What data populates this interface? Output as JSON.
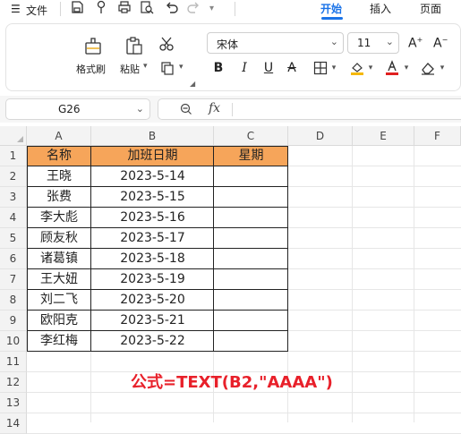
{
  "menubar": {
    "file_label": "文件",
    "tabs": [
      {
        "label": "开始",
        "active": true
      },
      {
        "label": "插入",
        "active": false
      },
      {
        "label": "页面",
        "active": false
      }
    ],
    "accent_color": "#1a73e8"
  },
  "ribbon": {
    "format_painter_label": "格式刷",
    "paste_label": "粘贴",
    "font_name": "宋体",
    "font_size": "11",
    "icons": [
      "format-painter-icon",
      "paste-icon",
      "cut-icon",
      "copy-icon",
      "increase-font-icon",
      "decrease-font-icon",
      "bold-icon",
      "italic-icon",
      "underline-icon",
      "strikethrough-icon",
      "border-icon",
      "fill-color-icon",
      "font-color-icon",
      "clear-icon"
    ],
    "fill_color": "#f5b800",
    "font_color": "#e02020"
  },
  "formula_bar": {
    "cell_ref": "G26",
    "fx_label": "fx",
    "content": ""
  },
  "sheet": {
    "columns": [
      "A",
      "B",
      "C",
      "D",
      "E",
      "F"
    ],
    "rows": [
      "1",
      "2",
      "3",
      "4",
      "5",
      "6",
      "7",
      "8",
      "9",
      "10",
      "11",
      "12",
      "13",
      "14"
    ],
    "table": {
      "headers": [
        "名称",
        "加班日期",
        "星期"
      ],
      "header_fill": "#f6a55a",
      "rows": [
        [
          "王晓",
          "2023-5-14",
          ""
        ],
        [
          "张费",
          "2023-5-15",
          ""
        ],
        [
          "李大彪",
          "2023-5-16",
          ""
        ],
        [
          "顾友秋",
          "2023-5-17",
          ""
        ],
        [
          "诸葛镇",
          "2023-5-18",
          ""
        ],
        [
          "王大妞",
          "2023-5-19",
          ""
        ],
        [
          "刘二飞",
          "2023-5-20",
          ""
        ],
        [
          "欧阳克",
          "2023-5-21",
          ""
        ],
        [
          "李红梅",
          "2023-5-22",
          ""
        ]
      ]
    },
    "annotation": "公式=TEXT(B2,\"AAAA\")",
    "annotation_color": "#e8202a"
  }
}
